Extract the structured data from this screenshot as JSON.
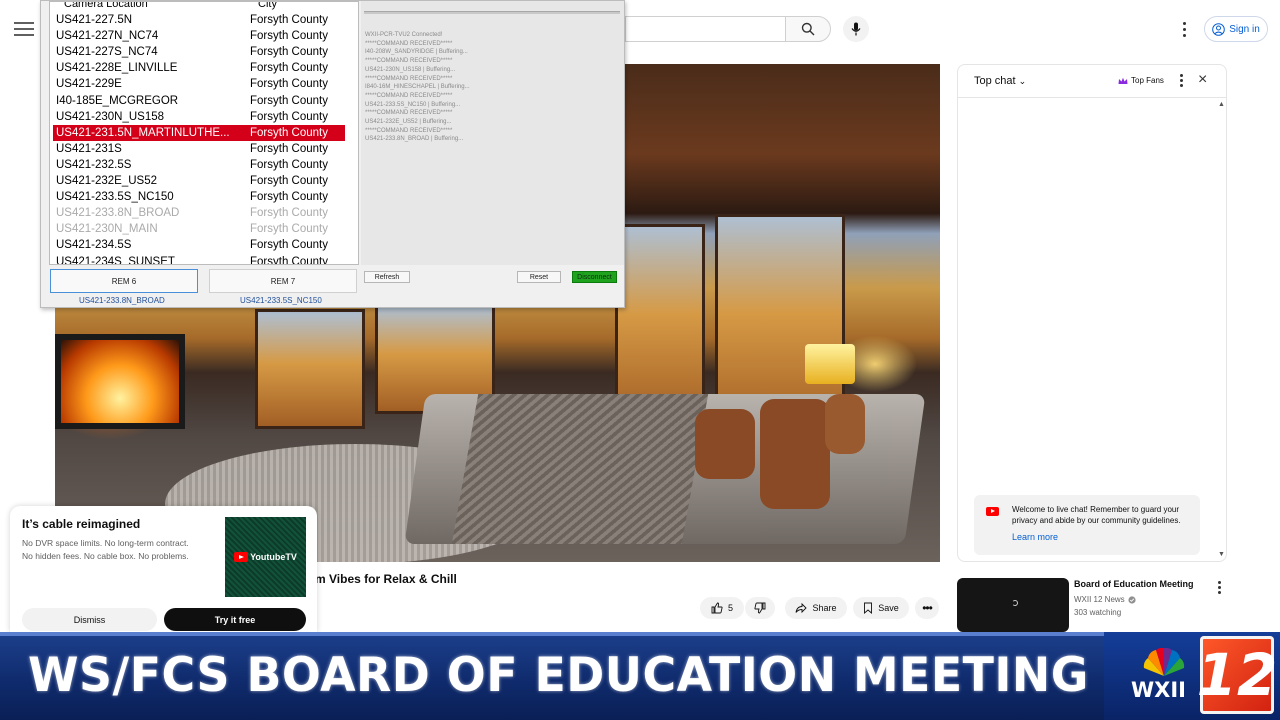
{
  "youtube": {
    "search_placeholder": "",
    "signin_label": "Sign in",
    "video_title_partial": "m Vibes for Relax & Chill",
    "actions": {
      "like_count": "5",
      "share_label": "Share",
      "save_label": "Save"
    },
    "chat": {
      "title": "Top chat",
      "top_fans_label": "Top Fans",
      "welcome_text": "Welcome to live chat! Remember to guard your privacy and abide by our community guidelines.",
      "learn_more": "Learn more"
    },
    "up_next": {
      "title": "Board of Education Meeting",
      "channel": "WXII 12 News",
      "watching": "303 watching"
    },
    "ad": {
      "title": "It’s cable reimagined",
      "body_line1": "No DVR space limits. No long-term contract.",
      "body_line2": "No hidden fees. No cable box. No problems.",
      "brand": "YoutubeTV",
      "dismiss": "Dismiss",
      "try": "Try it free"
    }
  },
  "camera_app": {
    "header_location": "Camera Location",
    "header_city": "City",
    "rows": [
      {
        "location": "US421-227.5N",
        "city": "Forsyth County",
        "state": "normal"
      },
      {
        "location": "US421-227N_NC74",
        "city": "Forsyth County",
        "state": "normal"
      },
      {
        "location": "US421-227S_NC74",
        "city": "Forsyth County",
        "state": "normal"
      },
      {
        "location": "US421-228E_LINVILLE",
        "city": "Forsyth County",
        "state": "normal"
      },
      {
        "location": "US421-229E",
        "city": "Forsyth County",
        "state": "normal"
      },
      {
        "location": "I40-185E_MCGREGOR",
        "city": "Forsyth County",
        "state": "normal"
      },
      {
        "location": "US421-230N_US158",
        "city": "Forsyth County",
        "state": "normal"
      },
      {
        "location": "US421-231.5N_MARTINLUTHE...",
        "city": "Forsyth County",
        "state": "selected"
      },
      {
        "location": "US421-231S",
        "city": "Forsyth County",
        "state": "normal"
      },
      {
        "location": "US421-232.5S",
        "city": "Forsyth County",
        "state": "normal"
      },
      {
        "location": "US421-232E_US52",
        "city": "Forsyth County",
        "state": "normal"
      },
      {
        "location": "US421-233.5S_NC150",
        "city": "Forsyth County",
        "state": "normal"
      },
      {
        "location": "US421-233.8N_BROAD",
        "city": "Forsyth County",
        "state": "dim"
      },
      {
        "location": "US421-230N_MAIN",
        "city": "Forsyth County",
        "state": "dim"
      },
      {
        "location": "US421-234.5S",
        "city": "Forsyth County",
        "state": "normal"
      },
      {
        "location": "US421-234S_SUNSET",
        "city": "Forsyth County",
        "state": "normal"
      }
    ],
    "log_lines": [
      "WXII-PCR-TVU2 Connected!",
      "*****COMMAND RECEIVED*****",
      "I40-208W_SANDYRIDGE | Buffering...",
      "*****COMMAND RECEIVED*****",
      "US421-230N_US158 | Buffering...",
      "*****COMMAND RECEIVED*****",
      "I840-16M_HINESCHAPEL | Buffering...",
      "*****COMMAND RECEIVED*****",
      "US421-233.5S_NC150 | Buffering...",
      "*****COMMAND RECEIVED*****",
      "US421-232E_US52 | Buffering...",
      "*****COMMAND RECEIVED*****",
      "US421-233.8N_BROAD | Buffering..."
    ],
    "rem6_label": "REM 6",
    "rem7_label": "REM 7",
    "rem6_sub": "US421-233.8N_BROAD",
    "rem7_sub": "US421-233.5S_NC150",
    "refresh": "Refresh",
    "reset": "Reset",
    "disconnect": "Disconnect"
  },
  "banner": {
    "headline": "WS/FCS BOARD OF EDUCATION MEETING",
    "station": "WXII",
    "channel_number": "12"
  },
  "colors": {
    "selected_row": "#d4001a",
    "banner_blue": "#0f2a6b",
    "youtube_red": "#ff0000",
    "link_blue": "#065fd4",
    "disconnect_green": "#1fa31f"
  }
}
